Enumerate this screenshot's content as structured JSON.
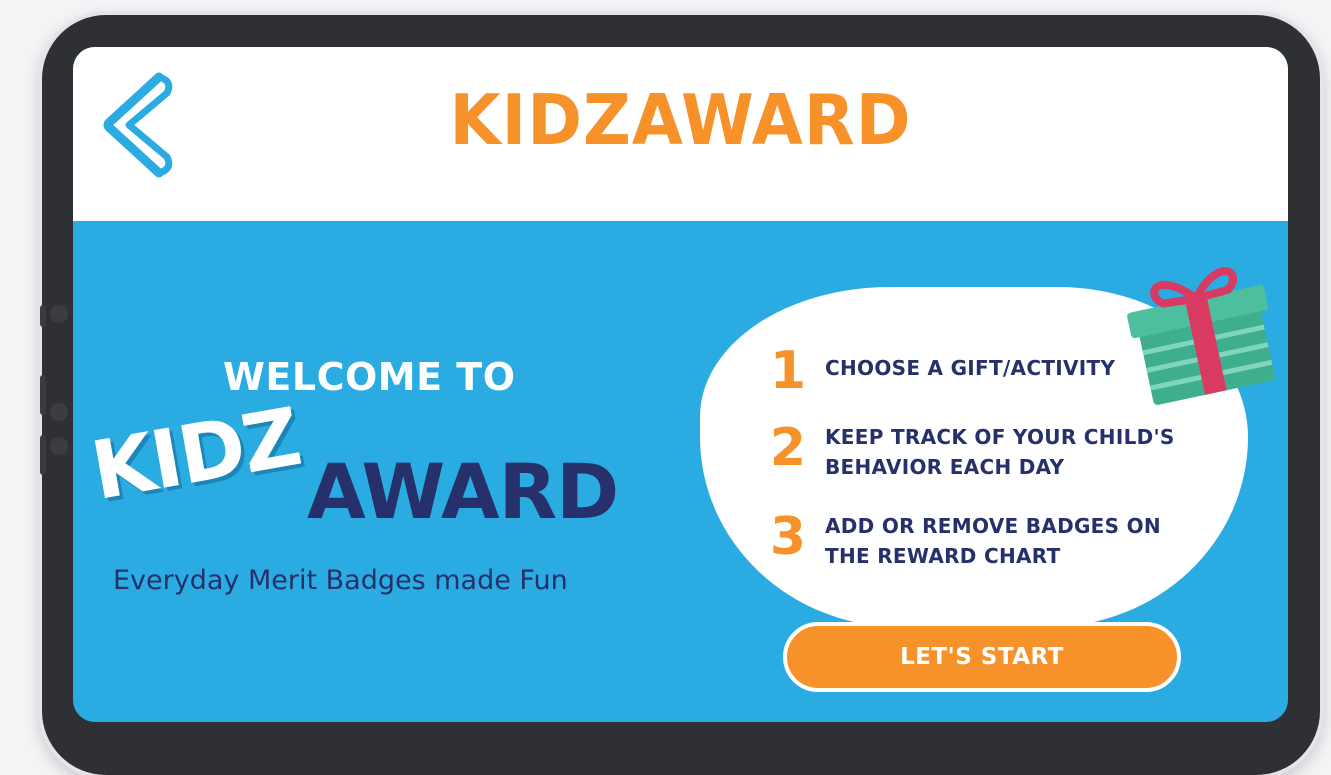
{
  "header": {
    "title": "KIDZAWARD",
    "back_icon": "chevron-left-icon"
  },
  "welcome": {
    "heading": "WELCOME TO",
    "logo_part1": "KIDZ",
    "logo_part2": "AWARD",
    "tagline": "Everyday Merit Badges made Fun"
  },
  "steps": [
    {
      "number": "1",
      "text": "CHOOSE A GIFT/ACTIVITY"
    },
    {
      "number": "2",
      "text": "KEEP TRACK OF YOUR CHILD'S\nBEHAVIOR EACH DAY"
    },
    {
      "number": "3",
      "text": "ADD OR REMOVE BADGES ON\nTHE REWARD CHART"
    }
  ],
  "start_button": {
    "label": "LET'S START"
  },
  "decorations": {
    "gift_icon": "gift-box-icon"
  },
  "colors": {
    "background_blue": "#2aace2",
    "brand_orange": "#f7922b",
    "navy": "#26306a",
    "gift_green": "#3fae8f",
    "ribbon_pink": "#d83a62"
  }
}
